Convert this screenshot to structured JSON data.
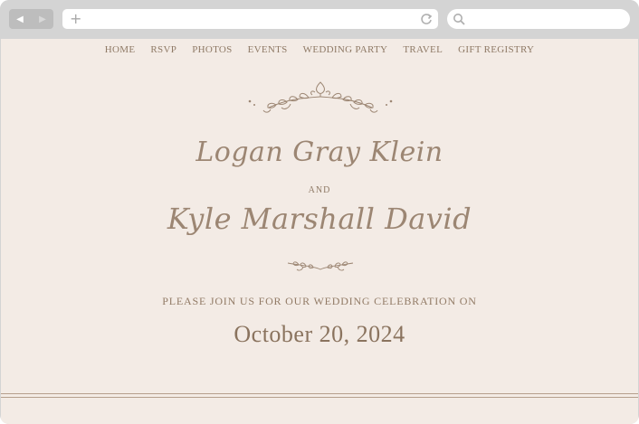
{
  "browser": {
    "back_icon": "back-arrow-icon",
    "forward_icon": "forward-arrow-icon",
    "plus_glyph": "+",
    "reload_icon": "reload-icon",
    "search_icon": "search-icon",
    "address_value": "",
    "search_value": ""
  },
  "nav": {
    "items": [
      "HOME",
      "RSVP",
      "PHOTOS",
      "EVENTS",
      "WEDDING PARTY",
      "TRAVEL",
      "GIFT REGISTRY"
    ]
  },
  "hero": {
    "name1": "Logan Gray Klein",
    "and_label": "AND",
    "name2": "Kyle Marshall David",
    "invite_text": "PLEASE JOIN US FOR OUR WEDDING CELEBRATION ON",
    "date": "October 20, 2024"
  },
  "colors": {
    "page_bg": "#f3ebe5",
    "accent": "#9c8673",
    "chrome": "#d4d4d4"
  }
}
